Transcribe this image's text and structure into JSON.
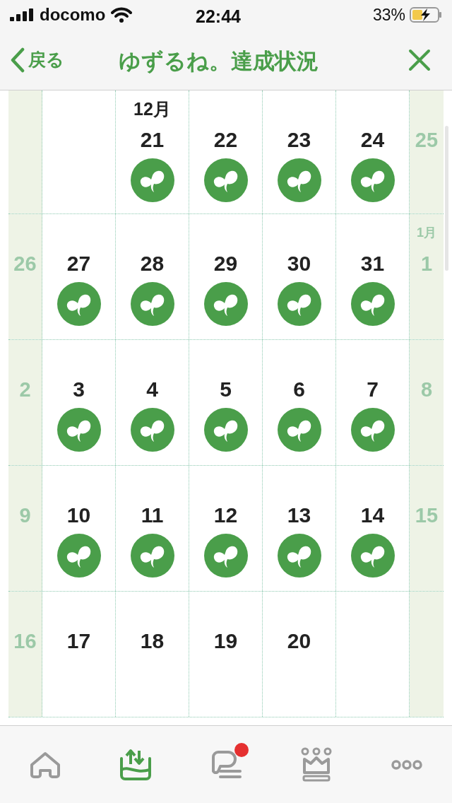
{
  "status_bar": {
    "carrier": "docomo",
    "time": "22:44",
    "battery": "33%"
  },
  "nav": {
    "back": "戻る",
    "title": "ゆずるね。達成状況"
  },
  "calendar": {
    "weeks": [
      {
        "days": [
          {
            "kind": "blank"
          },
          {
            "kind": "blank"
          },
          {
            "day": "21",
            "month": "12月",
            "stamp": true
          },
          {
            "day": "22",
            "stamp": true
          },
          {
            "day": "23",
            "stamp": true
          },
          {
            "day": "24",
            "stamp": true
          },
          {
            "day": "25",
            "stamp": false
          }
        ]
      },
      {
        "days": [
          {
            "day": "26",
            "stamp": false
          },
          {
            "day": "27",
            "stamp": true
          },
          {
            "day": "28",
            "stamp": true
          },
          {
            "day": "29",
            "stamp": true
          },
          {
            "day": "30",
            "stamp": true
          },
          {
            "day": "31",
            "stamp": true
          },
          {
            "day": "1",
            "month": "1月",
            "stamp": false
          }
        ]
      },
      {
        "days": [
          {
            "day": "2",
            "stamp": false
          },
          {
            "day": "3",
            "stamp": true
          },
          {
            "day": "4",
            "stamp": true
          },
          {
            "day": "5",
            "stamp": true
          },
          {
            "day": "6",
            "stamp": true
          },
          {
            "day": "7",
            "stamp": true
          },
          {
            "day": "8",
            "stamp": false
          }
        ]
      },
      {
        "days": [
          {
            "day": "9",
            "stamp": false
          },
          {
            "day": "10",
            "stamp": true
          },
          {
            "day": "11",
            "stamp": true
          },
          {
            "day": "12",
            "stamp": true
          },
          {
            "day": "13",
            "stamp": true
          },
          {
            "day": "14",
            "stamp": true
          },
          {
            "day": "15",
            "stamp": false
          }
        ]
      },
      {
        "days": [
          {
            "day": "16",
            "stamp": false
          },
          {
            "day": "17",
            "stamp": false
          },
          {
            "day": "18",
            "stamp": false
          },
          {
            "day": "19",
            "stamp": false
          },
          {
            "day": "20",
            "stamp": false
          },
          {
            "kind": "blank"
          },
          {
            "kind": "blank"
          }
        ]
      }
    ]
  },
  "tabs": [
    {
      "selected": false,
      "badge": false
    },
    {
      "selected": true,
      "badge": false
    },
    {
      "selected": false,
      "badge": true
    },
    {
      "selected": false,
      "badge": false
    },
    {
      "selected": false,
      "badge": false
    }
  ]
}
